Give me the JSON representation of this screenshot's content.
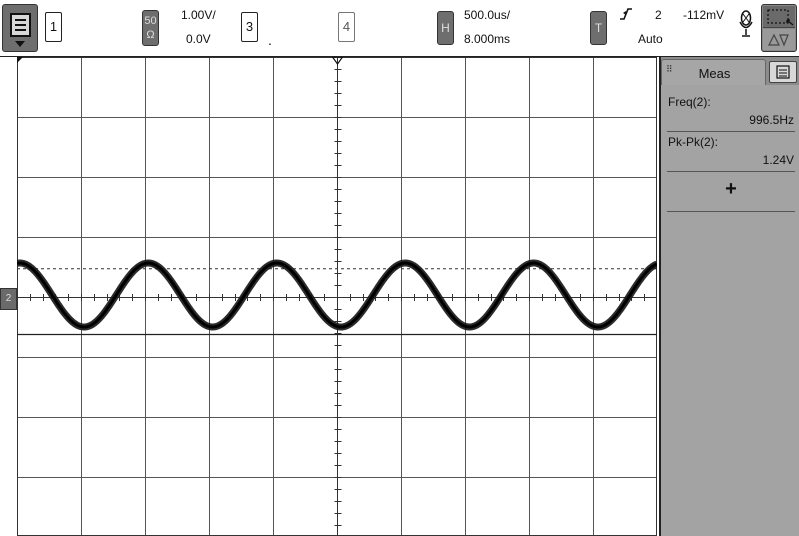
{
  "toolbar": {
    "channel1_label": "1",
    "impedance_top": "50",
    "impedance_bottom": "Ω",
    "ch2_scale": "1.00V/",
    "ch2_offset": "0.0V",
    "channel3_label": "3",
    "channel3_dot": ".",
    "channel4_label": "4",
    "horizontal_button": "H",
    "time_scale": "500.0us/",
    "time_delay": "8.000ms",
    "trigger_button": "T",
    "trigger_source": "2",
    "trigger_level": "-112mV",
    "trigger_mode": "Auto"
  },
  "screen": {
    "channel_marker": "2",
    "trace_color": "#1a1a1a",
    "grid_color": "#555555"
  },
  "waveform": {
    "frequency_hz": 996.5,
    "peak_to_peak_v": 1.24,
    "volts_per_div": 1.0,
    "seconds_per_div": 0.0005,
    "offset_v": 0.0,
    "trigger_level_v": -0.112,
    "dashed_level_v": 0.62
  },
  "measurements": {
    "tab_label": "Meas",
    "items": [
      {
        "label": "Freq(2):",
        "value": "996.5Hz"
      },
      {
        "label": "Pk-Pk(2):",
        "value": "1.24V"
      }
    ],
    "add_symbol": "+"
  },
  "icons": {
    "menu": "menu-icon",
    "trigger_slope": "rising-edge-icon",
    "mic": "microphone-icon",
    "select": "select-region-icon",
    "meas_menu": "list-menu-icon"
  }
}
